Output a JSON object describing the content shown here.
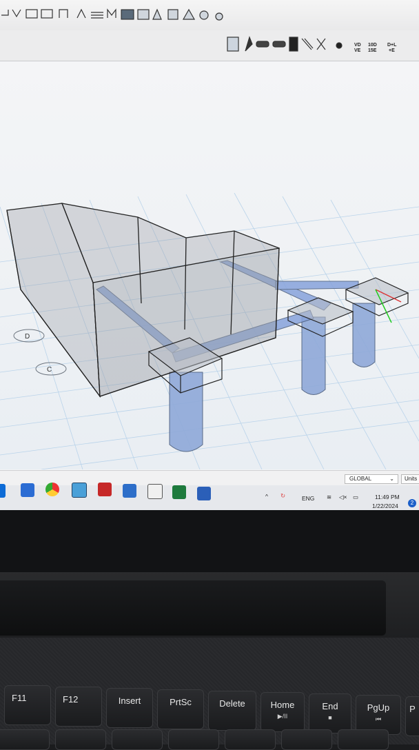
{
  "toolbar": {
    "view_icons": [
      "VD",
      "VE",
      "10D",
      "15E",
      "D+L",
      "+E"
    ]
  },
  "statusbar": {
    "coordinate_system": "GLOBAL",
    "units_label": "Units"
  },
  "viewport": {
    "axis_labels": [
      "D",
      "C"
    ]
  },
  "taskbar": {
    "language": "ENG",
    "time": "11:49 PM",
    "date": "1/22/2024",
    "notification_count": "2",
    "apps": [
      "windows-start",
      "file-explorer",
      "chrome",
      "sap2000",
      "autocad",
      "app-e",
      "calculator",
      "excel",
      "word"
    ]
  },
  "keyboard": {
    "keys": [
      {
        "label": "F11",
        "sub": ""
      },
      {
        "label": "F12",
        "sub": ""
      },
      {
        "label": "Insert",
        "sub": ""
      },
      {
        "label": "PrtSc",
        "sub": ""
      },
      {
        "label": "Delete",
        "sub": ""
      },
      {
        "label": "Home",
        "sub": "▶/II"
      },
      {
        "label": "End",
        "sub": "■"
      },
      {
        "label": "PgUp",
        "sub": "⏮"
      },
      {
        "label": "P",
        "sub": ""
      }
    ]
  },
  "colors": {
    "structure_blue": "#7f9fd8",
    "grid_line": "#b9d3ea",
    "wall_fill": "#9a9ea6"
  }
}
